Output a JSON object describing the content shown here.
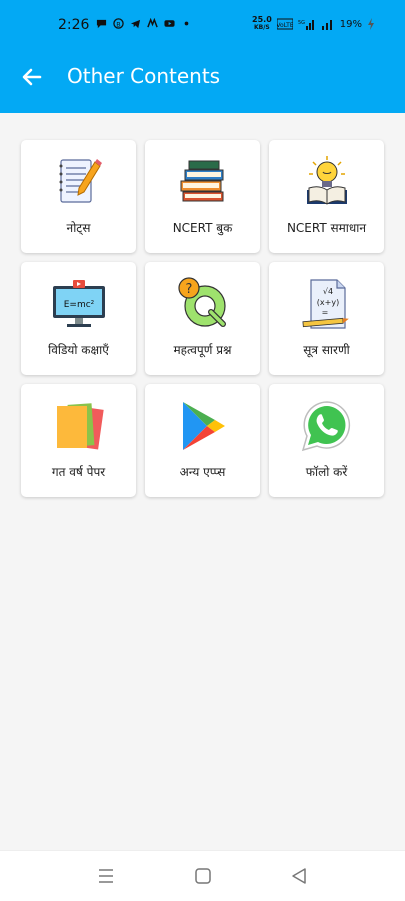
{
  "status_bar": {
    "time": "2:26",
    "net_speed_value": "25.0",
    "net_speed_unit": "KB/S",
    "battery": "19%"
  },
  "header": {
    "title": "Other Contents",
    "back_icon": "arrow-left-icon"
  },
  "items": [
    {
      "label": "नोट्स",
      "icon": "notepad-pencil-icon"
    },
    {
      "label": "NCERT बुक",
      "icon": "book-stack-icon"
    },
    {
      "label": "NCERT समाधान",
      "icon": "lightbulb-reader-icon"
    },
    {
      "label": "विडियो कक्षाएँ",
      "icon": "video-monitor-icon",
      "icon_text": "E=mc²"
    },
    {
      "label": "महत्वपूर्ण प्रश्न",
      "icon": "question-q-icon"
    },
    {
      "label": "सूत्र सारणी",
      "icon": "formula-sheet-icon",
      "icon_text": "√4 (x+y) ="
    },
    {
      "label": "गत वर्ष पेपर",
      "icon": "paper-stack-icon"
    },
    {
      "label": "अन्य एप्प्स",
      "icon": "play-store-icon"
    },
    {
      "label": "फॉलो करें",
      "icon": "whatsapp-icon"
    }
  ],
  "colors": {
    "primary": "#03a9f4",
    "background": "#f5f5f5",
    "card": "#ffffff"
  },
  "nav": {
    "menu_icon": "menu-lines-icon",
    "home_icon": "home-square-icon",
    "back_icon": "back-triangle-icon"
  }
}
